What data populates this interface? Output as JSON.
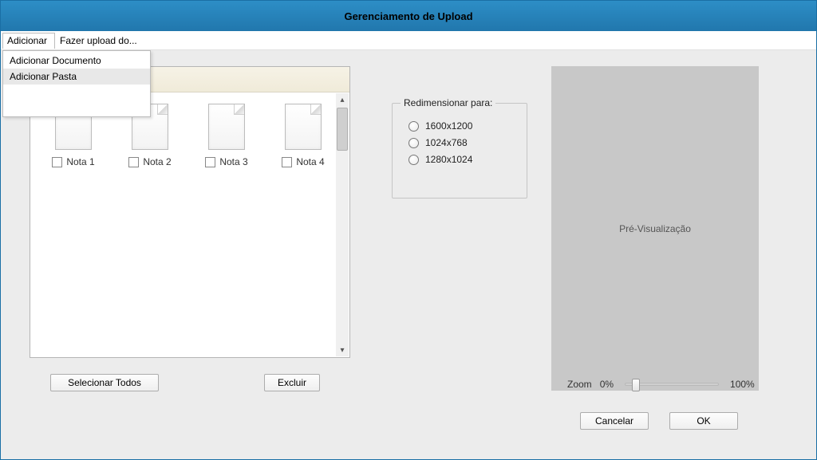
{
  "window": {
    "title": "Gerenciamento de Upload"
  },
  "menubar": {
    "add": "Adicionar",
    "upload": "Fazer upload do..."
  },
  "menu_dropdown": {
    "items": [
      {
        "label": "Adicionar Documento"
      },
      {
        "label": "Adicionar Pasta"
      }
    ]
  },
  "files": [
    {
      "label": "Nota 1"
    },
    {
      "label": "Nota 2"
    },
    {
      "label": "Nota 3"
    },
    {
      "label": "Nota 4"
    }
  ],
  "buttons": {
    "select_all": "Selecionar Todos",
    "delete": "Excluir",
    "cancel": "Cancelar",
    "ok": "OK"
  },
  "resize": {
    "legend": "Redimensionar para:",
    "options": [
      {
        "label": "1600x1200"
      },
      {
        "label": "1024x768"
      },
      {
        "label": "1280x1024"
      }
    ]
  },
  "preview": {
    "label": "Pré-Visualização"
  },
  "zoom": {
    "label": "Zoom",
    "min": "0%",
    "max": "100%"
  }
}
